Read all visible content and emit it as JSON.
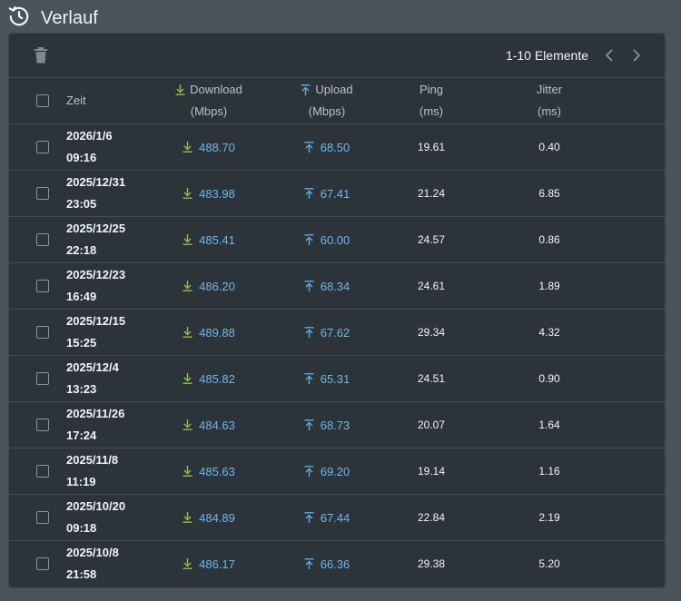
{
  "header": {
    "title": "Verlauf",
    "icon": "history-icon"
  },
  "toolbar": {
    "delete_icon": "trash-icon",
    "page_range": "1-10 Elemente"
  },
  "columns": {
    "time": "Zeit",
    "download": {
      "label": "Download",
      "unit": "(Mbps)"
    },
    "upload": {
      "label": "Upload",
      "unit": "(Mbps)"
    },
    "ping": {
      "label": "Ping",
      "unit": "(ms)"
    },
    "jitter": {
      "label": "Jitter",
      "unit": "(ms)"
    }
  },
  "colors": {
    "download_arrow": "#8bc34a",
    "upload_arrow": "#5aaee8",
    "value_blue": "#6ab8ee"
  },
  "rows": [
    {
      "date": "2026/1/6",
      "time": "09:16",
      "download": "488.70",
      "upload": "68.50",
      "ping": "19.61",
      "jitter": "0.40"
    },
    {
      "date": "2025/12/31",
      "time": "23:05",
      "download": "483.98",
      "upload": "67.41",
      "ping": "21.24",
      "jitter": "6.85"
    },
    {
      "date": "2025/12/25",
      "time": "22:18",
      "download": "485.41",
      "upload": "60.00",
      "ping": "24.57",
      "jitter": "0.86"
    },
    {
      "date": "2025/12/23",
      "time": "16:49",
      "download": "486.20",
      "upload": "68.34",
      "ping": "24.61",
      "jitter": "1.89"
    },
    {
      "date": "2025/12/15",
      "time": "15:25",
      "download": "489.88",
      "upload": "67.62",
      "ping": "29.34",
      "jitter": "4.32"
    },
    {
      "date": "2025/12/4",
      "time": "13:23",
      "download": "485.82",
      "upload": "65.31",
      "ping": "24.51",
      "jitter": "0.90"
    },
    {
      "date": "2025/11/26",
      "time": "17:24",
      "download": "484.63",
      "upload": "68.73",
      "ping": "20.07",
      "jitter": "1.64"
    },
    {
      "date": "2025/11/8",
      "time": "11:19",
      "download": "485.63",
      "upload": "69.20",
      "ping": "19.14",
      "jitter": "1.16"
    },
    {
      "date": "2025/10/20",
      "time": "09:18",
      "download": "484.89",
      "upload": "67.44",
      "ping": "22.84",
      "jitter": "2.19"
    },
    {
      "date": "2025/10/8",
      "time": "21:58",
      "download": "486.17",
      "upload": "66.36",
      "ping": "29.38",
      "jitter": "5.20"
    }
  ]
}
